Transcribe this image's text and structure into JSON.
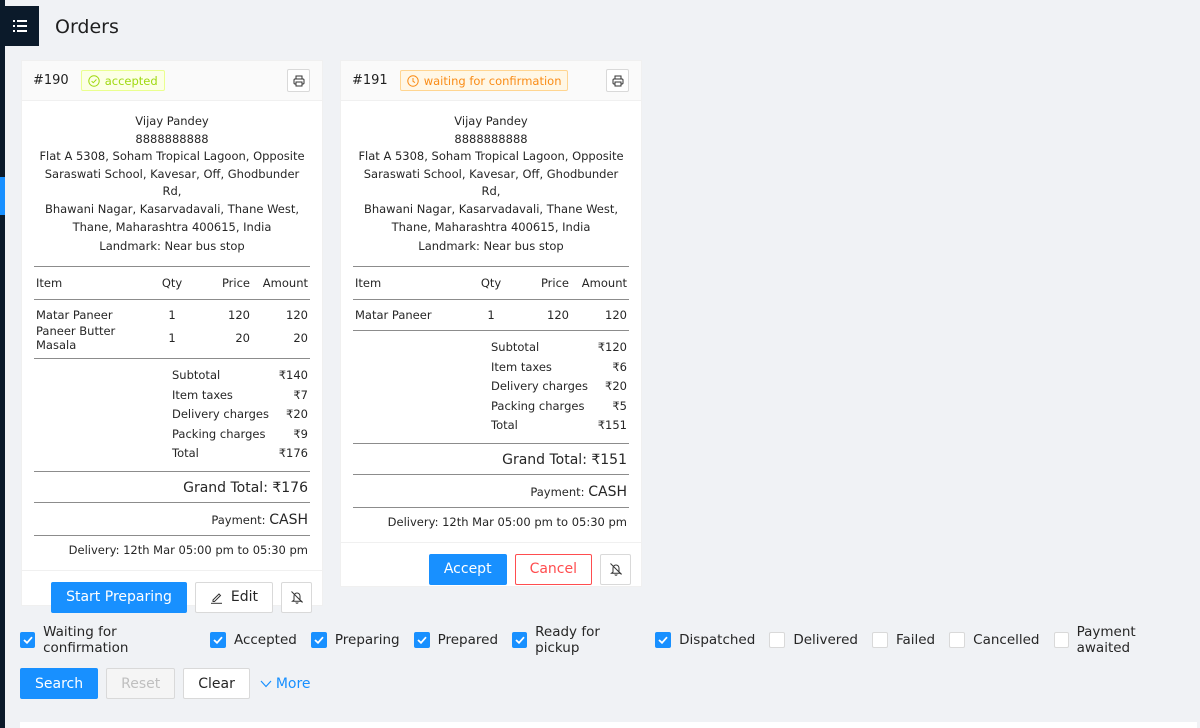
{
  "header": {
    "title": "Orders",
    "menu_icon": "list-icon"
  },
  "orders": [
    {
      "id": "#190",
      "status": "accepted",
      "status_icon": "check-circle-icon",
      "customer": {
        "name": "Vijay Pandey",
        "phone": "8888888888",
        "address_lines": [
          "Flat A 5308, Soham Tropical Lagoon, Opposite",
          "Saraswati School, Kavesar, Off, Ghodbunder Rd,",
          "Bhawani Nagar, Kasarvadavali, Thane West,",
          "Thane, Maharashtra 400615, India"
        ],
        "landmark": "Landmark: Near bus stop"
      },
      "columns": [
        "Item",
        "Qty",
        "Price",
        "Amount"
      ],
      "items": [
        {
          "name": "Matar Paneer",
          "qty": "1",
          "price": "120",
          "amount": "120"
        },
        {
          "name": "Paneer Butter Masala",
          "qty": "1",
          "price": "20",
          "amount": "20"
        }
      ],
      "summary": [
        {
          "label": "Subtotal",
          "value": "₹140"
        },
        {
          "label": "Item taxes",
          "value": "₹7"
        },
        {
          "label": "Delivery charges",
          "value": "₹20"
        },
        {
          "label": "Packing charges",
          "value": "₹9"
        },
        {
          "label": "Total",
          "value": "₹176"
        }
      ],
      "grand_total": "Grand Total: ₹176",
      "payment_label": "Payment:",
      "payment_value": "CASH",
      "delivery": "Delivery: 12th Mar 05:00 pm to 05:30 pm",
      "actions": {
        "primary": "Start Preparing",
        "edit": "Edit"
      }
    },
    {
      "id": "#191",
      "status": "waiting for confirmation",
      "status_icon": "clock-icon",
      "customer": {
        "name": "Vijay Pandey",
        "phone": "8888888888",
        "address_lines": [
          "Flat A 5308, Soham Tropical Lagoon, Opposite",
          "Saraswati School, Kavesar, Off, Ghodbunder Rd,",
          "Bhawani Nagar, Kasarvadavali, Thane West,",
          "Thane, Maharashtra 400615, India"
        ],
        "landmark": "Landmark: Near bus stop"
      },
      "columns": [
        "Item",
        "Qty",
        "Price",
        "Amount"
      ],
      "items": [
        {
          "name": "Matar Paneer",
          "qty": "1",
          "price": "120",
          "amount": "120"
        }
      ],
      "summary": [
        {
          "label": "Subtotal",
          "value": "₹120"
        },
        {
          "label": "Item taxes",
          "value": "₹6"
        },
        {
          "label": "Delivery charges",
          "value": "₹20"
        },
        {
          "label": "Packing charges",
          "value": "₹5"
        },
        {
          "label": "Total",
          "value": "₹151"
        }
      ],
      "grand_total": "Grand Total: ₹151",
      "payment_label": "Payment:",
      "payment_value": "CASH",
      "delivery": "Delivery: 12th Mar 05:00 pm to 05:30 pm",
      "actions": {
        "accept": "Accept",
        "cancel": "Cancel"
      }
    }
  ],
  "filters": [
    {
      "label": "Waiting for confirmation",
      "checked": true
    },
    {
      "label": "Accepted",
      "checked": true
    },
    {
      "label": "Preparing",
      "checked": true
    },
    {
      "label": "Prepared",
      "checked": true
    },
    {
      "label": "Ready for pickup",
      "checked": true
    },
    {
      "label": "Dispatched",
      "checked": true
    },
    {
      "label": "Delivered",
      "checked": false
    },
    {
      "label": "Failed",
      "checked": false
    },
    {
      "label": "Cancelled",
      "checked": false
    },
    {
      "label": "Payment awaited",
      "checked": false
    }
  ],
  "toolbar": {
    "search": "Search",
    "reset": "Reset",
    "clear": "Clear",
    "more": "More"
  },
  "colors": {
    "primary": "#1890ff",
    "sidebar": "#0b1a2a",
    "accepted": "#a0d911",
    "waiting": "#fa8c16",
    "danger": "#ff4d4f"
  }
}
